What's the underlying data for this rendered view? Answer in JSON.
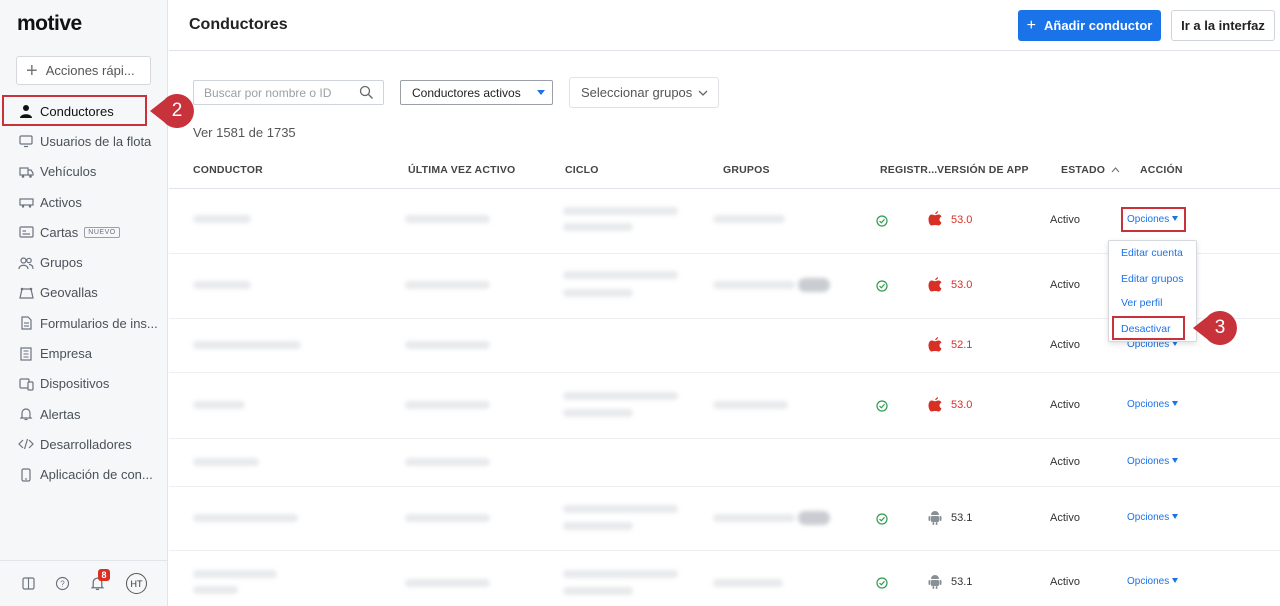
{
  "sidebar": {
    "logo": "motive",
    "quick_actions": "Acciones rápi...",
    "items": [
      {
        "label": "Conductores",
        "icon": "person-icon"
      },
      {
        "label": "Usuarios de la flota",
        "icon": "monitor-icon"
      },
      {
        "label": "Vehículos",
        "icon": "truck-icon"
      },
      {
        "label": "Activos",
        "icon": "trailer-icon"
      },
      {
        "label": "Cartas",
        "icon": "card-icon",
        "badge": "NUEVO"
      },
      {
        "label": "Grupos",
        "icon": "group-icon"
      },
      {
        "label": "Geovallas",
        "icon": "geofence-icon"
      },
      {
        "label": "Formularios de ins...",
        "icon": "document-icon"
      },
      {
        "label": "Empresa",
        "icon": "building-icon"
      },
      {
        "label": "Dispositivos",
        "icon": "devices-icon"
      },
      {
        "label": "Alertas",
        "icon": "bell-icon"
      },
      {
        "label": "Desarrolladores",
        "icon": "code-icon"
      },
      {
        "label": "Aplicación de con...",
        "icon": "phone-icon"
      }
    ],
    "footer": {
      "notification_count": "8",
      "avatar_initials": "HT"
    }
  },
  "header": {
    "title": "Conductores",
    "add_button": "Añadir conductor",
    "interface_button": "Ir a la interfaz"
  },
  "filters": {
    "search_placeholder": "Buscar por nombre o ID",
    "status_select": "Conductores activos",
    "groups_select": "Seleccionar grupos",
    "count_text": "Ver 1581 de 1735"
  },
  "table": {
    "columns": [
      "CONDUCTOR",
      "ÚLTIMA VEZ ACTIVO",
      "CICLO",
      "GRUPOS",
      "REGISTR...",
      "VERSIÓN DE APP",
      "ESTADO",
      "ACCIÓN"
    ],
    "rows": [
      {
        "registered": true,
        "platform": "ios",
        "app_version": "53.0",
        "status": "Activo",
        "action": "Opciones"
      },
      {
        "registered": true,
        "platform": "ios",
        "app_version": "53.0",
        "status": "Activo",
        "action": "Opciones"
      },
      {
        "registered": false,
        "platform": "ios",
        "app_version": "52.1",
        "status": "Activo",
        "action": "Opciones"
      },
      {
        "registered": true,
        "platform": "ios",
        "app_version": "53.0",
        "status": "Activo",
        "action": "Opciones"
      },
      {
        "registered": false,
        "platform": "",
        "app_version": "",
        "status": "Activo",
        "action": "Opciones"
      },
      {
        "registered": true,
        "platform": "android",
        "app_version": "53.1",
        "status": "Activo",
        "action": "Opciones"
      },
      {
        "registered": true,
        "platform": "android",
        "app_version": "53.1",
        "status": "Activo",
        "action": "Opciones"
      }
    ]
  },
  "options_menu": {
    "items": [
      "Editar cuenta",
      "Editar grupos",
      "Ver perfil",
      "Desactivar"
    ]
  },
  "annotations": {
    "step_2": "2",
    "step_3": "3",
    "highlight_color": "#c8323a"
  },
  "colors": {
    "primary": "#1a73e8",
    "ios_version": "#d93025",
    "check": "#2e9e4f"
  }
}
